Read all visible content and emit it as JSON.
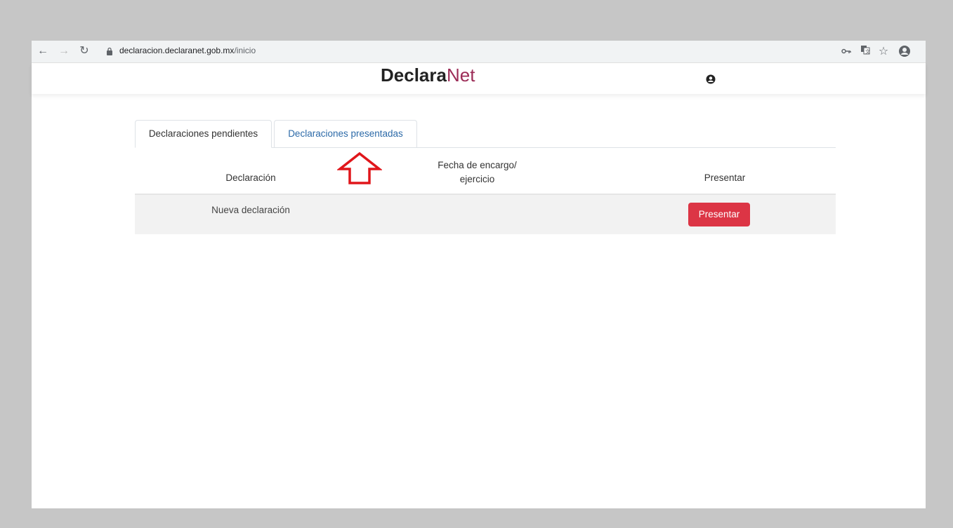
{
  "browser": {
    "url_host": "declaracion.declaranet.gob.mx",
    "url_path": "/inicio",
    "icons": [
      "back-arrow-icon",
      "forward-arrow-icon",
      "reload-icon",
      "lock-icon",
      "key-icon",
      "translate-icon",
      "star-icon",
      "profile-icon"
    ]
  },
  "header": {
    "logo_bold": "Declara",
    "logo_light": "Net",
    "user_icon": "user-circle-icon"
  },
  "tabs": [
    {
      "label": "Declaraciones pendientes",
      "active": true
    },
    {
      "label": "Declaraciones presentadas",
      "active": false
    }
  ],
  "table": {
    "headers": {
      "declaracion": "Declaración",
      "fecha_line1": "Fecha de encargo/",
      "fecha_line2": "ejercicio",
      "presentar": "Presentar"
    },
    "rows": [
      {
        "declaracion": "Nueva declaración",
        "fecha": "",
        "button_label": "Presentar"
      }
    ]
  },
  "annotation": {
    "icon": "up-arrow-outline-icon",
    "color": "#e0161b"
  },
  "colors": {
    "brand_light": "#9c2c57",
    "button": "#dc3545",
    "link_tab": "#2c6aa8"
  }
}
